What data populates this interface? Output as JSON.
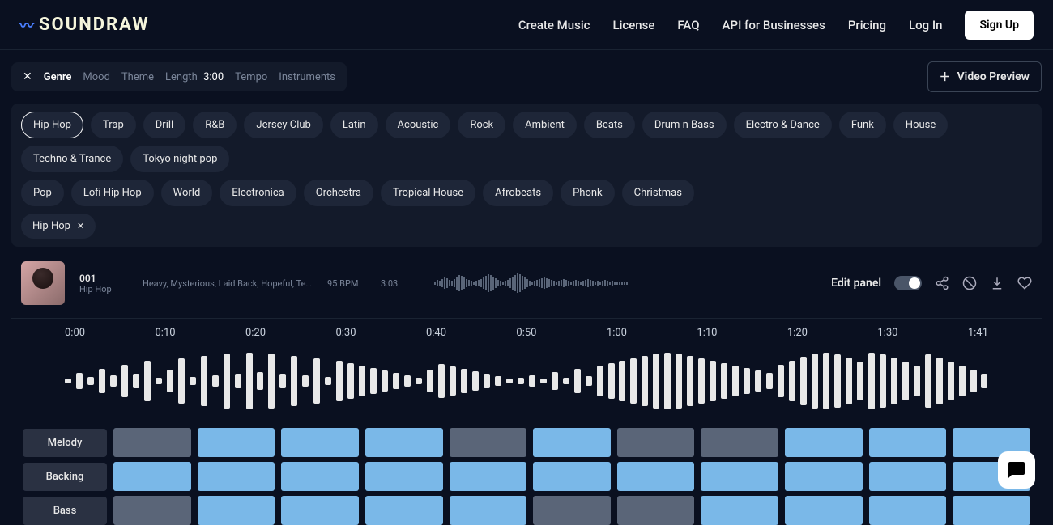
{
  "brand": "SOUNDRAW",
  "nav": {
    "create": "Create Music",
    "license": "License",
    "faq": "FAQ",
    "api": "API for Businesses",
    "pricing": "Pricing",
    "login": "Log In",
    "signup": "Sign Up"
  },
  "filters": {
    "genre": "Genre",
    "mood": "Mood",
    "theme": "Theme",
    "length_label": "Length",
    "length_value": "3:00",
    "tempo": "Tempo",
    "instruments": "Instruments"
  },
  "video_preview": "Video Preview",
  "genres_row1": [
    "Hip Hop",
    "Trap",
    "Drill",
    "R&B",
    "Jersey Club",
    "Latin",
    "Acoustic",
    "Rock",
    "Ambient",
    "Beats",
    "Drum n Bass",
    "Electro & Dance",
    "Funk",
    "House",
    "Techno & Trance",
    "Tokyo night pop"
  ],
  "genres_row2": [
    "Pop",
    "Lofi Hip Hop",
    "World",
    "Electronica",
    "Orchestra",
    "Tropical House",
    "Afrobeats",
    "Phonk",
    "Christmas"
  ],
  "selected_genre_index": 0,
  "active_tag": "Hip Hop",
  "track": {
    "id": "001",
    "genre": "Hip Hop",
    "moods": "Heavy, Mysterious, Laid Back, Hopeful, Technol...",
    "bpm": "95 BPM",
    "duration": "3:03",
    "edit_panel": "Edit panel"
  },
  "timeline": [
    "0:00",
    "0:10",
    "0:20",
    "0:30",
    "0:40",
    "0:50",
    "1:00",
    "1:10",
    "1:20",
    "1:30",
    "1:41"
  ],
  "rows": {
    "melody": {
      "label": "Melody",
      "cells": [
        "off",
        "on",
        "on",
        "on",
        "off",
        "on",
        "off",
        "off",
        "on",
        "on",
        "on"
      ]
    },
    "backing": {
      "label": "Backing",
      "cells": [
        "on",
        "on",
        "on",
        "on",
        "on",
        "on",
        "on",
        "on",
        "on",
        "on",
        "on"
      ]
    },
    "bass": {
      "label": "Bass",
      "cells": [
        "off",
        "on",
        "on",
        "on",
        "on",
        "off",
        "off",
        "on",
        "on",
        "on",
        "on"
      ]
    }
  },
  "mini_wave_heights": [
    4,
    8,
    6,
    10,
    14,
    12,
    8,
    6,
    10,
    16,
    20,
    18,
    14,
    10,
    8,
    6,
    4,
    6,
    8,
    10,
    14,
    18,
    22,
    20,
    16,
    12,
    8,
    6,
    4,
    6,
    8,
    12,
    16,
    20,
    24,
    22,
    18,
    14,
    10,
    6,
    4,
    6,
    8,
    10,
    12,
    14,
    12,
    10,
    8,
    6,
    4,
    6,
    8,
    10,
    8,
    6,
    4,
    6,
    8,
    6,
    4,
    6,
    8,
    10,
    8,
    6,
    4,
    6,
    4,
    6,
    8,
    6,
    4,
    6,
    4,
    4,
    4,
    4,
    4,
    4
  ],
  "big_wave_heights": [
    6,
    20,
    10,
    30,
    14,
    40,
    18,
    50,
    8,
    28,
    56,
    10,
    62,
    14,
    68,
    18,
    70,
    22,
    68,
    18,
    62,
    14,
    56,
    10,
    50,
    44,
    38,
    32,
    26,
    20,
    14,
    8,
    28,
    42,
    36,
    30,
    24,
    18,
    12,
    6,
    8,
    14,
    6,
    22,
    8,
    30,
    12,
    38,
    44,
    50,
    56,
    62,
    68,
    70,
    68,
    62,
    56,
    50,
    44,
    38,
    32,
    26,
    20,
    40,
    50,
    60,
    68,
    70,
    66,
    58,
    48,
    70,
    66,
    58,
    48,
    38,
    66,
    58,
    48,
    38,
    28,
    18
  ]
}
